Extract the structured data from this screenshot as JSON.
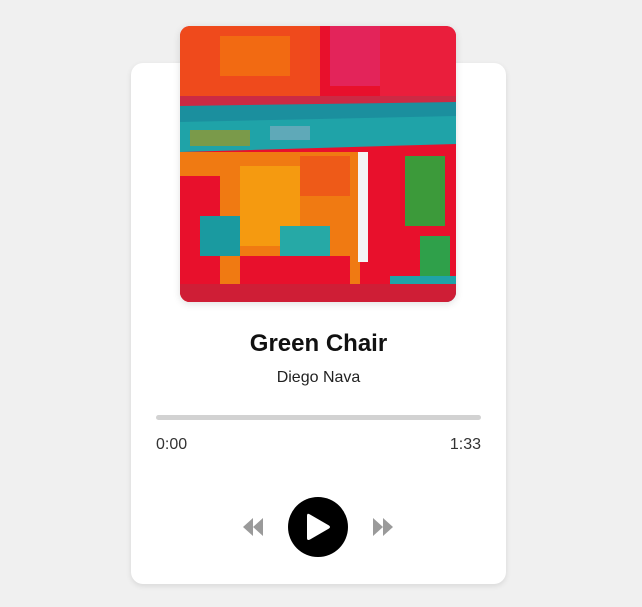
{
  "track": {
    "title": "Green Chair",
    "artist": "Diego Nava"
  },
  "progress": {
    "current_time": "0:00",
    "total_time": "1:33",
    "fraction": 0
  },
  "controls": {
    "prev_icon": "rewind-icon",
    "play_icon": "play-icon",
    "next_icon": "fast-forward-icon"
  },
  "colors": {
    "background": "#f0f0f0",
    "card": "#ffffff",
    "play_button": "#000000",
    "progress_track": "#d2d2d2",
    "skip_icons": "#9a9a9a"
  }
}
